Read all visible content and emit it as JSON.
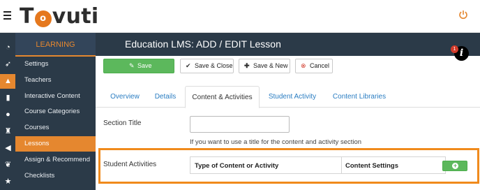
{
  "brand": {
    "logo_left": "T",
    "logo_o": "o",
    "logo_right": "vuti",
    "accent": "#e5872f",
    "sidebar_bg": "#2b3a48",
    "save_green": "#5cb85c",
    "highlight": "#f08a1c"
  },
  "sidebar": {
    "title": "LEARNING",
    "items": [
      {
        "label": "Settings"
      },
      {
        "label": "Teachers"
      },
      {
        "label": "Interactive Content"
      },
      {
        "label": "Course Categories"
      },
      {
        "label": "Courses"
      },
      {
        "label": "Lessons"
      },
      {
        "label": "Assign & Recommend"
      },
      {
        "label": "Checklists"
      }
    ],
    "active": "Lessons"
  },
  "icon_rail": [
    "gauge-icon",
    "rocket-icon",
    "graduation-cap-icon",
    "bar-chart-icon",
    "users-icon",
    "trophy-icon",
    "megaphone-icon",
    "leaf-icon",
    "star-icon"
  ],
  "header": {
    "title": "Education LMS: ADD / EDIT Lesson",
    "info_badge": "1",
    "info_glyph": "i"
  },
  "toolbar": {
    "save": "Save",
    "save_close": "Save & Close",
    "save_new": "Save & New",
    "cancel": "Cancel"
  },
  "tabs": [
    {
      "label": "Overview"
    },
    {
      "label": "Details"
    },
    {
      "label": "Content & Activities",
      "active": true
    },
    {
      "label": "Student Activity"
    },
    {
      "label": "Content Libraries"
    }
  ],
  "form": {
    "section_title_label": "Section Title",
    "section_title_value": "",
    "section_title_help": "If you want to use a title for the content and activity section",
    "student_activities_label": "Student Activities",
    "table_headers": [
      "Type of Content or Activity",
      "Content Settings"
    ],
    "add_button": "+"
  }
}
